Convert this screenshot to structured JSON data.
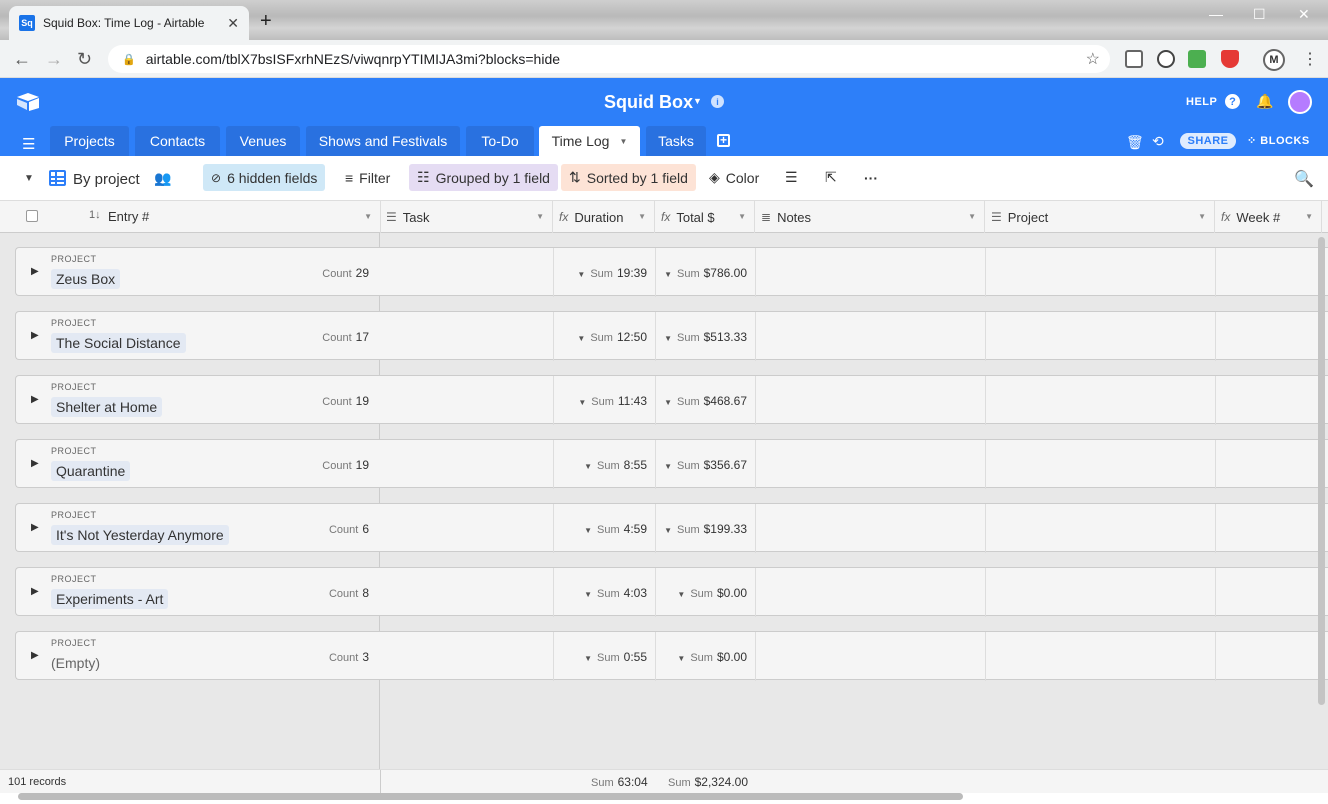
{
  "browser": {
    "tab_title": "Squid Box: Time Log - Airtable",
    "tab_favicon": "Sq",
    "url": "airtable.com/tblX7bsISFxrhNEzS/viwqnrpYTIMIJA3mi?blocks=hide",
    "profile_initial": "M"
  },
  "app": {
    "base_name": "Squid Box",
    "help_label": "HELP",
    "share_label": "SHARE",
    "blocks_label": "BLOCKS",
    "accent_color": "#2d7ff9"
  },
  "tables": [
    {
      "label": "Projects"
    },
    {
      "label": "Contacts"
    },
    {
      "label": "Venues"
    },
    {
      "label": "Shows and Festivals"
    },
    {
      "label": "To-Do"
    },
    {
      "label": "Time Log",
      "active": true
    },
    {
      "label": "Tasks"
    }
  ],
  "viewbar": {
    "view_name": "By project",
    "hidden_fields": "6 hidden fields",
    "filter": "Filter",
    "grouped": "Grouped by 1 field",
    "sorted": "Sorted by 1 field",
    "color": "Color"
  },
  "columns": [
    {
      "label": "Entry #",
      "icon": "autonumber-icon"
    },
    {
      "label": "Task",
      "icon": "link-icon"
    },
    {
      "label": "Duration",
      "icon": "formula-icon"
    },
    {
      "label": "Total $",
      "icon": "formula-icon"
    },
    {
      "label": "Notes",
      "icon": "long-text-icon"
    },
    {
      "label": "Project",
      "icon": "link-icon"
    },
    {
      "label": "Week #",
      "icon": "formula-icon"
    }
  ],
  "group_label": "PROJECT",
  "count_label": "Count",
  "sum_label": "Sum",
  "groups": [
    {
      "name": "Zeus Box",
      "count": "29",
      "duration": "19:39",
      "total": "$786.00"
    },
    {
      "name": "The Social Distance",
      "count": "17",
      "duration": "12:50",
      "total": "$513.33"
    },
    {
      "name": "Shelter at Home",
      "count": "19",
      "duration": "11:43",
      "total": "$468.67"
    },
    {
      "name": "Quarantine",
      "count": "19",
      "duration": "8:55",
      "total": "$356.67"
    },
    {
      "name": "It's Not Yesterday Anymore",
      "count": "6",
      "duration": "4:59",
      "total": "$199.33"
    },
    {
      "name": "Experiments - Art",
      "count": "8",
      "duration": "4:03",
      "total": "$0.00"
    },
    {
      "name": "(Empty)",
      "count": "3",
      "duration": "0:55",
      "total": "$0.00"
    }
  ],
  "footer": {
    "records": "101 records",
    "duration_sum": "63:04",
    "total_sum": "$2,324.00"
  }
}
